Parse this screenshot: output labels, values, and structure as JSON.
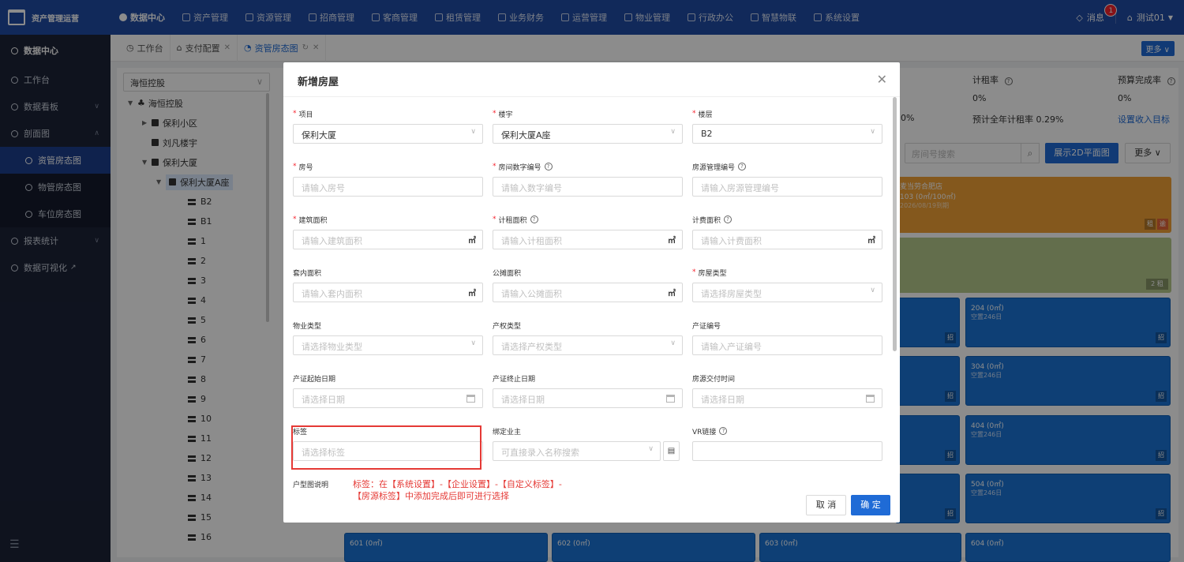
{
  "topbar": {
    "logo": "资产管理运营",
    "nav": [
      "数据中心",
      "资产管理",
      "资源管理",
      "招商管理",
      "客商管理",
      "租赁管理",
      "业务财务",
      "运营管理",
      "物业管理",
      "行政办公",
      "智慧物联",
      "系统设置"
    ],
    "message_label": "消息",
    "message_count": "1",
    "user": "测试01"
  },
  "sidebar": {
    "header": "数据中心",
    "items": [
      "工作台",
      "数据看板",
      "剖面图",
      "资管房态图",
      "物管房态图",
      "车位房态图",
      "报表统计",
      "数据可视化"
    ]
  },
  "tabs": [
    "工作台",
    "支付配置",
    "资管房态图"
  ],
  "more_label": "更多",
  "tree": {
    "select_value": "海恒控股",
    "nodes": [
      "海恒控股",
      "保利小区",
      "刘凡楼宇",
      "保利大厦",
      "保利大厦A座",
      "B2",
      "B1",
      "1",
      "2",
      "3",
      "4",
      "5",
      "6",
      "7",
      "8",
      "9",
      "10",
      "11",
      "12",
      "13",
      "14",
      "15",
      "16"
    ]
  },
  "stats": {
    "rent_rate_label": "计租率",
    "budget_rate_label": "预算完成率",
    "rent_rate_value": "0%",
    "budget_rate_value": "0%",
    "partial_pct": "0%",
    "annual_rate": "预计全年计租率 0.29%",
    "set_target": "设置收入目标"
  },
  "right_toolbar": {
    "search_placeholder": "房间号搜索",
    "show_2d": "展示2D平面图",
    "more": "更多"
  },
  "cards": {
    "orange_title": "麦当劳合肥店",
    "orange_line2": "103 (0㎡/100㎡)",
    "orange_line3": "2026/08/19到期",
    "tag_rent": "租",
    "tag_overdue": "逾",
    "green_tag": "2 租",
    "tag_invest": "招",
    "vacant": "空置246日",
    "r204": "204 (0㎡)",
    "r304": "304 (0㎡)",
    "r404": "404 (0㎡)",
    "r504": "504 (0㎡)",
    "r601": "601 (0㎡)",
    "r602": "602 (0㎡)",
    "r603": "603 (0㎡)",
    "r604": "604 (0㎡)"
  },
  "modal": {
    "title": "新增房屋",
    "fields": {
      "project": {
        "label": "项目",
        "value": "保利大厦"
      },
      "building": {
        "label": "楼宇",
        "value": "保利大厦A座"
      },
      "floor": {
        "label": "楼层",
        "value": "B2"
      },
      "room_no": {
        "label": "房号",
        "placeholder": "请输入房号"
      },
      "room_num_code": {
        "label": "房间数字编号",
        "placeholder": "请输入数字编号"
      },
      "mgmt_code": {
        "label": "房源管理编号",
        "placeholder": "请输入房源管理编号"
      },
      "build_area": {
        "label": "建筑面积",
        "placeholder": "请输入建筑面积"
      },
      "rent_area": {
        "label": "计租面积",
        "placeholder": "请输入计租面积"
      },
      "bill_area": {
        "label": "计费面积",
        "placeholder": "请输入计费面积"
      },
      "inner_area": {
        "label": "套内面积",
        "placeholder": "请输入套内面积"
      },
      "shared_area": {
        "label": "公摊面积",
        "placeholder": "请输入公摊面积"
      },
      "room_type": {
        "label": "房屋类型",
        "placeholder": "请选择房屋类型"
      },
      "prop_type": {
        "label": "物业类型",
        "placeholder": "请选择物业类型"
      },
      "title_type": {
        "label": "产权类型",
        "placeholder": "请选择产权类型"
      },
      "cert_no": {
        "label": "产证编号",
        "placeholder": "请输入产证编号"
      },
      "cert_start": {
        "label": "产证起始日期",
        "placeholder": "请选择日期"
      },
      "cert_end": {
        "label": "产证终止日期",
        "placeholder": "请选择日期"
      },
      "handover": {
        "label": "房源交付时间",
        "placeholder": "请选择日期"
      },
      "tag": {
        "label": "标签",
        "placeholder": "请选择标签"
      },
      "owner": {
        "label": "绑定业主",
        "placeholder": "可直接录入名称搜索"
      },
      "vr_link": {
        "label": "VR链接",
        "placeholder": ""
      },
      "floor_plan": {
        "label": "户型图说明"
      }
    },
    "unit": "㎡",
    "annotation": "标签：在【系统设置】-【企业设置】-【自定义标签】-【房源标签】中添加完成后即可进行选择",
    "cancel": "取 消",
    "confirm": "确 定"
  }
}
